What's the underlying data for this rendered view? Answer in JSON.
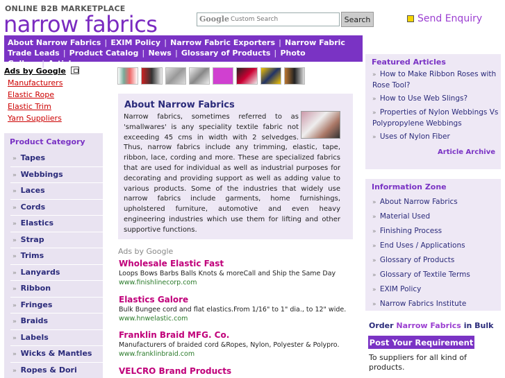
{
  "header": {
    "tagline": "ONLINE B2B MARKETPLACE",
    "logo": "narrow fabrics",
    "search_brand": "Google",
    "search_placeholder": "Custom Search",
    "search_button": "Search",
    "enquiry": "Send Enquiry"
  },
  "nav": {
    "items": [
      "About Narrow Fabrics",
      "EXIM Policy",
      "Narrow Fabric Exporters",
      "Narrow Fabric Trade Leads",
      "Product Catalog",
      "News",
      "Glossary of Products",
      "Photo Gallery",
      "Articles"
    ]
  },
  "left_ads": {
    "heading": "Ads by Google",
    "links": [
      "Manufacturers",
      "Elastic Rope",
      "Elastic Trim",
      "Yarn Suppliers"
    ]
  },
  "category": {
    "title": "Product Category",
    "items": [
      "Tapes",
      "Webbings",
      "Laces",
      "Cords",
      "Elastics",
      "Strap",
      "Trims",
      "Lanyards",
      "Ribbon",
      "Fringes",
      "Braids",
      "Labels",
      "Wicks & Mantles",
      "Ropes & Dori"
    ]
  },
  "about": {
    "title": "About Narrow Fabrics",
    "text": "Narrow fabrics, sometimes referred to as 'smallwares' is any speciality textile fabric not exceeding 45 cms in width with 2 selvedges. Thus, narrow fabrics include any trimming, elastic, tape, ribbon, lace, cording and more. These are specialized fabrics that are used for individual as well as industrial purposes for decorating and providing support as well as adding value to various products. Some of the industries that widely use narrow fabrics include garments, home furnishings, upholstered furniture, automotive and even heavy engineering industries which use them for lifting and other supportive functions."
  },
  "center_ads": {
    "label": "Ads by Google",
    "items": [
      {
        "title": "Wholesale Elastic Fast",
        "desc": "Loops Bows Barbs Balls Knots & moreCall and Ship the Same Day",
        "url": "www.finishlinecorp.com"
      },
      {
        "title": "Elastics Galore",
        "desc": "Bulk Bungee cord and flat elastics.From 1/16\" to 1\" dia., to 12\" wide.",
        "url": "www.hnwelastic.com"
      },
      {
        "title": "Franklin Braid MFG. Co.",
        "desc": "Manufacturers of braided cord &Ropes, Nylon, Polyester & Polypro.",
        "url": "www.franklinbraid.com"
      },
      {
        "title": "VELCRO Brand Products",
        "desc": "",
        "url": ""
      }
    ]
  },
  "featured": {
    "title": "Featured Articles",
    "items": [
      "How to Make Ribbon Roses with Rose Tool?",
      "How to Use Web Slings?",
      "Properties of Nylon Webbings Vs Polypropylene Webbings",
      "Uses of Nylon Fiber"
    ],
    "archive": "Article Archive"
  },
  "info_zone": {
    "title": "Information Zone",
    "items": [
      "About Narrow Fabrics",
      "Material Used",
      "Finishing Process",
      "End Uses / Applications",
      "Glossary of Products",
      "Glossary of Textile Terms",
      "EXIM Policy",
      "Narrow Fabrics Institute"
    ]
  },
  "order": {
    "prefix": "Order",
    "highlight": "Narrow Fabrics",
    "suffix": "in Bulk",
    "button": "Post Your Requirement",
    "note": "To suppliers for all kind of products."
  },
  "colors": {
    "brand": "#7a33c4",
    "ad_title": "#c0007a",
    "ad_url": "#2a7a2a",
    "link_red": "#cc0000"
  }
}
